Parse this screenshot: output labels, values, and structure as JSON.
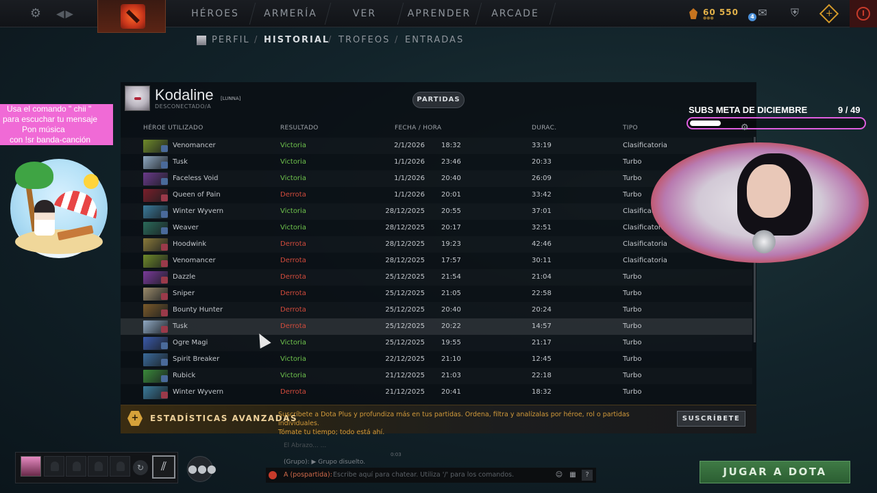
{
  "topnav": {
    "tabs": [
      "HÉROES",
      "ARMERÍA",
      "VER",
      "APRENDER",
      "ARCADE"
    ],
    "gold": "60 550",
    "notification_count": "4"
  },
  "subnav": {
    "items": [
      "PERFIL",
      "HISTORIAL",
      "TROFEOS",
      "ENTRADAS"
    ],
    "separator": "/",
    "active": "HISTORIAL"
  },
  "profile": {
    "name": "Kodaline",
    "tag": "[LUNNA]",
    "status": "DESCONECTADO/A",
    "filter_button": "PARTIDAS"
  },
  "table": {
    "headers": [
      "HÉROE UTILIZADO",
      "RESULTADO",
      "FECHA / HORA",
      "DURAC.",
      "TIPO"
    ],
    "rows": [
      {
        "hero": "Venomancer",
        "result": "Victoria",
        "win": true,
        "date": "2/1/2026",
        "time": "18:32",
        "duration": "33:19",
        "type": "Clasificatoria",
        "color": "#6f8a2a"
      },
      {
        "hero": "Tusk",
        "result": "Victoria",
        "win": true,
        "date": "1/1/2026",
        "time": "23:46",
        "duration": "20:33",
        "type": "Turbo",
        "color": "#8fa8c2"
      },
      {
        "hero": "Faceless Void",
        "result": "Victoria",
        "win": true,
        "date": "1/1/2026",
        "time": "20:40",
        "duration": "26:09",
        "type": "Turbo",
        "color": "#6a3a8a"
      },
      {
        "hero": "Queen of Pain",
        "result": "Derrota",
        "win": false,
        "date": "1/1/2026",
        "time": "20:01",
        "duration": "33:42",
        "type": "Turbo",
        "color": "#7a1e2a"
      },
      {
        "hero": "Winter Wyvern",
        "result": "Victoria",
        "win": true,
        "date": "28/12/2025",
        "time": "20:55",
        "duration": "37:01",
        "type": "Clasificatoria",
        "color": "#3a7a9a"
      },
      {
        "hero": "Weaver",
        "result": "Victoria",
        "win": true,
        "date": "28/12/2025",
        "time": "20:17",
        "duration": "32:51",
        "type": "Clasificatoria",
        "color": "#2a6a5a"
      },
      {
        "hero": "Hoodwink",
        "result": "Derrota",
        "win": false,
        "date": "28/12/2025",
        "time": "19:23",
        "duration": "42:46",
        "type": "Clasificatoria",
        "color": "#8a7a3a"
      },
      {
        "hero": "Venomancer",
        "result": "Derrota",
        "win": false,
        "date": "28/12/2025",
        "time": "17:57",
        "duration": "30:11",
        "type": "Clasificatoria",
        "color": "#6f8a2a"
      },
      {
        "hero": "Dazzle",
        "result": "Derrota",
        "win": false,
        "date": "25/12/2025",
        "time": "21:54",
        "duration": "21:04",
        "type": "Turbo",
        "color": "#7a3a9a"
      },
      {
        "hero": "Sniper",
        "result": "Derrota",
        "win": false,
        "date": "25/12/2025",
        "time": "21:05",
        "duration": "22:58",
        "type": "Turbo",
        "color": "#9a8a6a"
      },
      {
        "hero": "Bounty Hunter",
        "result": "Derrota",
        "win": false,
        "date": "25/12/2025",
        "time": "20:40",
        "duration": "20:24",
        "type": "Turbo",
        "color": "#7a5a2a"
      },
      {
        "hero": "Tusk",
        "result": "Derrota",
        "win": false,
        "date": "25/12/2025",
        "time": "20:22",
        "duration": "14:57",
        "type": "Turbo",
        "color": "#8fa8c2"
      },
      {
        "hero": "Ogre Magi",
        "result": "Victoria",
        "win": true,
        "date": "25/12/2025",
        "time": "19:55",
        "duration": "21:17",
        "type": "Turbo",
        "color": "#3a5aaa"
      },
      {
        "hero": "Spirit Breaker",
        "result": "Victoria",
        "win": true,
        "date": "22/12/2025",
        "time": "21:10",
        "duration": "12:45",
        "type": "Turbo",
        "color": "#3a6a9a"
      },
      {
        "hero": "Rubick",
        "result": "Victoria",
        "win": true,
        "date": "21/12/2025",
        "time": "21:03",
        "duration": "22:18",
        "type": "Turbo",
        "color": "#3a8a3a"
      },
      {
        "hero": "Winter Wyvern",
        "result": "Derrota",
        "win": false,
        "date": "21/12/2025",
        "time": "20:41",
        "duration": "18:32",
        "type": "Turbo",
        "color": "#3a7a9a"
      }
    ],
    "highlighted_index": 11
  },
  "dota_plus": {
    "title": "ESTADÍSTICAS AVANZADAS",
    "desc_line1": "Suscríbete a Dota Plus y profundiza más en tus partidas. Ordena, filtra y analízalas por héroe, rol o partidas individuales.",
    "desc_line2": "Tómate tu tiempo; todo está ahí.",
    "button": "SUSCRÍBETE"
  },
  "overlay": {
    "command_lines": [
      "Usa el comando  \" chii  \"",
      "para escuchar tu mensaje",
      "Pon música",
      "con !sr banda-canción"
    ],
    "subs_title": "SUBS META DE DICIEMBRE",
    "subs_count": "9   / 49",
    "subs_progress": 0.18
  },
  "chat": {
    "faded": "El Abrazo... ...",
    "time": "0:03",
    "line": "(Grupo): ▶ Grupo disuelto.",
    "prefix": "A (pospartida):",
    "placeholder": "Escribe aquí para chatear. Utiliza '/' para los comandos.",
    "help": "?"
  },
  "play_button": "JUGAR A DOTA",
  "colors": {
    "victory": "#6ec24c",
    "defeat": "#d24b3c",
    "gold": "#e3b24a",
    "accent_pink": "#f06ad6"
  }
}
